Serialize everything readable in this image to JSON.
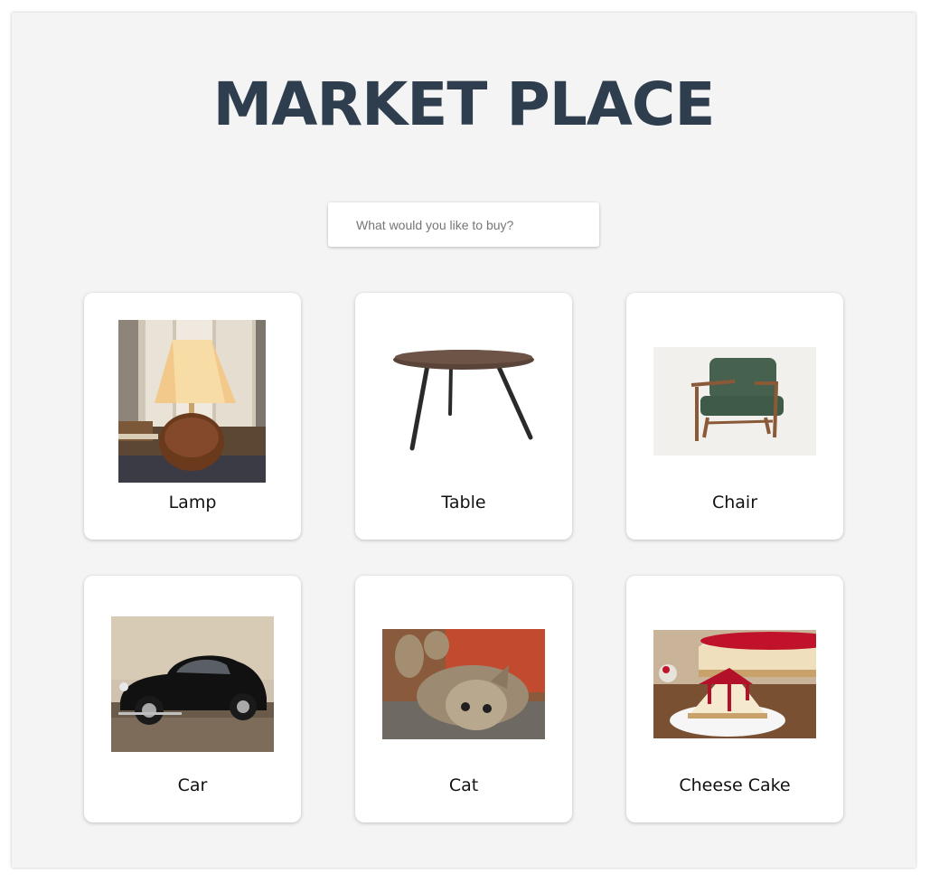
{
  "header": {
    "title": "MARKET PLACE"
  },
  "search": {
    "placeholder": "What would you like to buy?",
    "value": ""
  },
  "products": [
    {
      "name": "Lamp",
      "image": "lamp-image"
    },
    {
      "name": "Table",
      "image": "table-image"
    },
    {
      "name": "Chair",
      "image": "chair-image"
    },
    {
      "name": "Car",
      "image": "car-image"
    },
    {
      "name": "Cat",
      "image": "cat-image"
    },
    {
      "name": "Cheese Cake",
      "image": "cheese-cake-image"
    }
  ],
  "colors": {
    "title": "#2f3e4e",
    "panel": "#f4f4f4",
    "card": "#ffffff"
  }
}
